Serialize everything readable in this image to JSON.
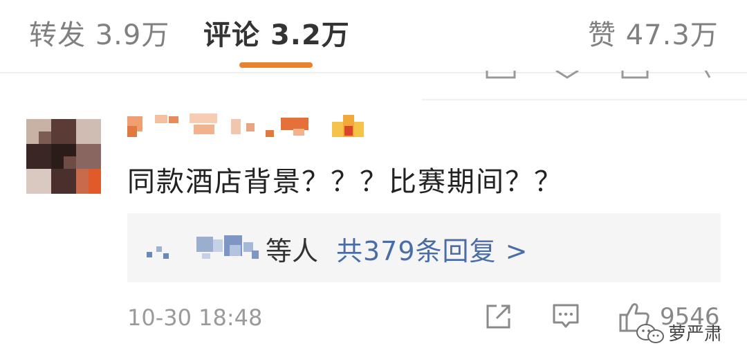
{
  "tabs": [
    {
      "label": "转发",
      "count": "3.9万",
      "active": false
    },
    {
      "label": "评论",
      "count": "3.2万",
      "active": true
    },
    {
      "label": "赞",
      "count": "47.3万",
      "active": false
    }
  ],
  "comment": {
    "text": "同款酒店背景？？？比赛期间？？",
    "reply_summary": {
      "suffix": "等人",
      "link": "共379条回复 >"
    },
    "timestamp": "10-30 18:48",
    "like_count": "9546"
  },
  "icons": {
    "share": "share-icon",
    "comment": "comment-icon",
    "like": "thumbs-up-icon"
  },
  "watermark": {
    "text": "萝严肃"
  },
  "colors": {
    "accent": "#e8822f",
    "link": "#4a6da7",
    "text_primary": "#222222",
    "text_muted": "#9a9a9a",
    "reply_bg": "#f5f5f5"
  }
}
